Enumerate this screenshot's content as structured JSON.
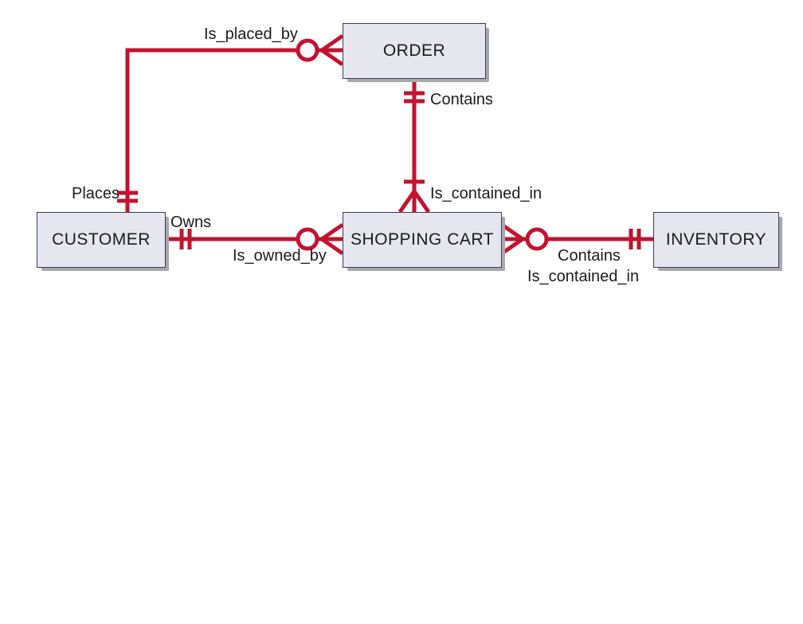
{
  "entities": {
    "customer": "CUSTOMER",
    "order": "ORDER",
    "shopping_cart": "SHOPPING CART",
    "inventory": "INVENTORY"
  },
  "relationships": {
    "customer_order": {
      "label_a": "Places",
      "label_b": "Is_placed_by"
    },
    "customer_cart": {
      "label_a": "Owns",
      "label_b": "Is_owned_by"
    },
    "order_cart": {
      "label_a": "Contains",
      "label_b": "Is_contained_in"
    },
    "cart_inventory": {
      "label_a": "Contains",
      "label_b": "Is_contained_in"
    }
  }
}
